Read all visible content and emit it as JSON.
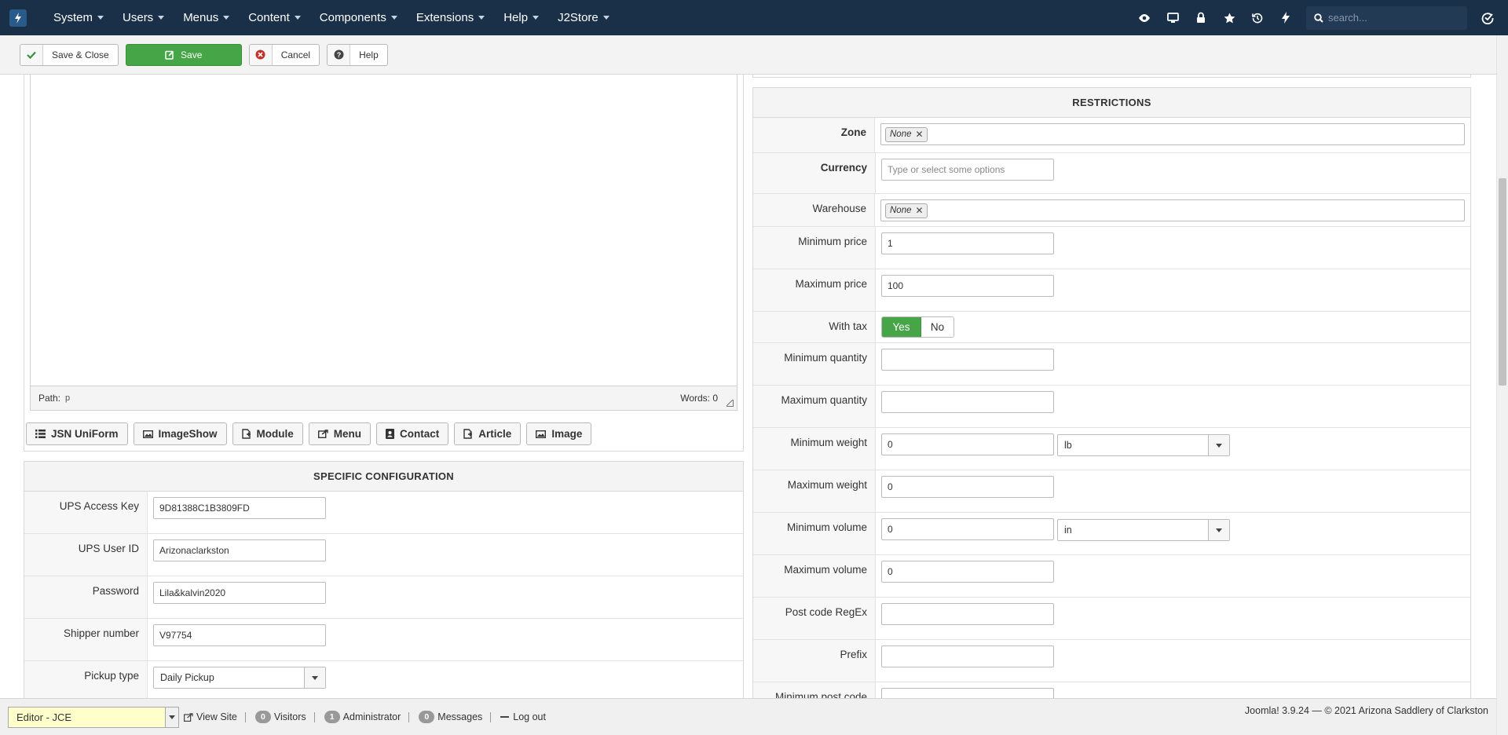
{
  "nav": {
    "menu": [
      "System",
      "Users",
      "Menus",
      "Content",
      "Components",
      "Extensions",
      "Help",
      "J2Store"
    ],
    "search_placeholder": "search..."
  },
  "toolbar": {
    "save_close": "Save & Close",
    "save": "Save",
    "cancel": "Cancel",
    "help": "Help"
  },
  "editor": {
    "path_label": "Path:",
    "path_value": "p",
    "words": "Words: 0",
    "buttons": [
      "JSN UniForm",
      "ImageShow",
      "Module",
      "Menu",
      "Contact",
      "Article",
      "Image"
    ]
  },
  "specific": {
    "title": "SPECIFIC CONFIGURATION",
    "ups_access_key_label": "UPS Access Key",
    "ups_access_key": "9D81388C1B3809FD",
    "ups_user_id_label": "UPS User ID",
    "ups_user_id": "Arizonaclarkston",
    "password_label": "Password",
    "password": "Lila&kalvin2020",
    "shipper_number_label": "Shipper number",
    "shipper_number": "V97754",
    "pickup_type_label": "Pickup type",
    "pickup_type": "Daily Pickup"
  },
  "restrictions": {
    "title": "RESTRICTIONS",
    "zone_label": "Zone",
    "zone_chip": "None",
    "currency_label": "Currency",
    "currency_placeholder": "Type or select some options",
    "warehouse_label": "Warehouse",
    "warehouse_chip": "None",
    "min_price_label": "Minimum price",
    "min_price": "1",
    "max_price_label": "Maximum price",
    "max_price": "100",
    "with_tax_label": "With tax",
    "yes": "Yes",
    "no": "No",
    "min_qty_label": "Minimum quantity",
    "max_qty_label": "Maximum quantity",
    "min_weight_label": "Minimum weight",
    "min_weight": "0",
    "weight_unit": "lb",
    "max_weight_label": "Maximum weight",
    "max_weight": "0",
    "min_volume_label": "Minimum volume",
    "min_volume": "0",
    "volume_unit": "in",
    "max_volume_label": "Maximum volume",
    "max_volume": "0",
    "postcode_regex_label": "Post code RegEx",
    "prefix_label": "Prefix",
    "min_postcode_label": "Minimum post code"
  },
  "footer": {
    "editor_select": "Editor - JCE",
    "view_site": "View Site",
    "visitors_count": "0",
    "visitors": "Visitors",
    "admin_count": "1",
    "administrator": "Administrator",
    "messages_count": "0",
    "messages": "Messages",
    "logout": "Log out",
    "copyright": "Joomla! 3.9.24  —  © 2021 Arizona Saddlery of Clarkston"
  }
}
